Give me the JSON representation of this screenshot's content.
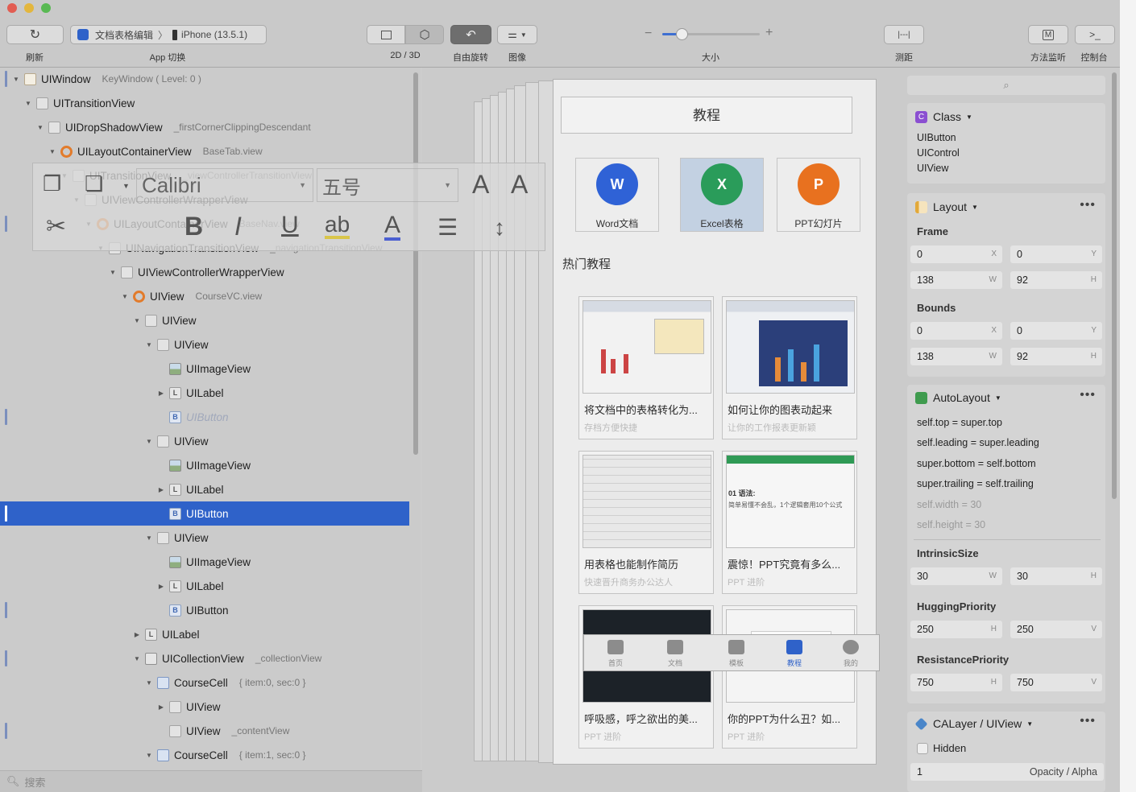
{
  "window_controls": {
    "colors": [
      "#e25d52",
      "#e3b63d",
      "#59b953"
    ]
  },
  "toolbar": {
    "refresh_label": "刷新",
    "app_switch_label": "App 切换",
    "app_name": "文档表格编辑",
    "device_name": "iPhone (13.5.1)",
    "view_mode_label": "2D / 3D",
    "free_rotate_label": "自由旋转",
    "image_label": "图像",
    "size_label": "大小",
    "measure_label": "测距",
    "measure_icon": "|---|",
    "method_monitor_label": "方法监听",
    "console_label": "控制台",
    "method_icon": "M",
    "console_icon": ">_",
    "zoom_level": 0.2
  },
  "hierarchy": [
    {
      "label": "UIWindow",
      "sub": "KeyWindow ( Level: 0 )",
      "icon": "window-icon"
    },
    {
      "label": "UITransitionView",
      "sub": "",
      "icon": "view-icon"
    },
    {
      "label": "UIDropShadowView",
      "sub": "_firstCornerClippingDescendant",
      "icon": "view-icon"
    },
    {
      "label": "UILayoutContainerView",
      "sub": "BaseTab.view",
      "icon": "controller-icon"
    },
    {
      "label": "UITransitionView",
      "sub": "_viewControllerTransitionView",
      "icon": "view-icon"
    },
    {
      "label": "UIViewControllerWrapperView",
      "sub": "",
      "icon": "view-icon"
    },
    {
      "label": "UILayoutContainerView",
      "sub": "BaseNav.view",
      "icon": "controller-icon"
    },
    {
      "label": "UINavigationTransitionView",
      "sub": "_navigationTransitionView",
      "icon": "view-icon"
    },
    {
      "label": "UIViewControllerWrapperView",
      "sub": "",
      "icon": "view-icon"
    },
    {
      "label": "UIView",
      "sub": "CourseVC.view",
      "icon": "controller-icon"
    },
    {
      "label": "UIView",
      "sub": "",
      "icon": "view-icon"
    },
    {
      "label": "UIView",
      "sub": "",
      "icon": "view-icon"
    },
    {
      "label": "UIImageView",
      "sub": "",
      "icon": "image-icon"
    },
    {
      "label": "UILabel",
      "sub": "",
      "icon": "label-icon"
    },
    {
      "label": "UIButton",
      "sub": "",
      "icon": "button-icon"
    },
    {
      "label": "UIView",
      "sub": "",
      "icon": "view-icon"
    },
    {
      "label": "UIImageView",
      "sub": "",
      "icon": "image-icon"
    },
    {
      "label": "UILabel",
      "sub": "",
      "icon": "label-icon"
    },
    {
      "label": "UIButton",
      "sub": "",
      "icon": "button-icon"
    },
    {
      "label": "UIView",
      "sub": "",
      "icon": "view-icon"
    },
    {
      "label": "UIImageView",
      "sub": "",
      "icon": "image-icon"
    },
    {
      "label": "UILabel",
      "sub": "",
      "icon": "label-icon"
    },
    {
      "label": "UIButton",
      "sub": "",
      "icon": "button-icon"
    },
    {
      "label": "UILabel",
      "sub": "",
      "icon": "label-icon"
    },
    {
      "label": "UICollectionView",
      "sub": "_collectionView",
      "icon": "collection-icon"
    },
    {
      "label": "CourseCell",
      "sub": "{ item:0, sec:0 }",
      "icon": "cell-icon"
    },
    {
      "label": "UIView",
      "sub": "",
      "icon": "view-icon"
    },
    {
      "label": "UIView",
      "sub": "_contentView",
      "icon": "view-icon"
    },
    {
      "label": "CourseCell",
      "sub": "{ item:1, sec:0 }",
      "icon": "cell-icon"
    }
  ],
  "hierarchy_search_placeholder": "搜索",
  "format_bar": {
    "font_name": "Calibri",
    "font_size": "五号"
  },
  "phone": {
    "nav_title": "教程",
    "apps": [
      {
        "label": "Word文档",
        "glyph": "W",
        "color": "#2f62d6"
      },
      {
        "label": "Excel表格",
        "glyph": "X",
        "color": "#2a9c5a"
      },
      {
        "label": "PPT幻灯片",
        "glyph": "P",
        "color": "#e8711f"
      }
    ],
    "section_title": "热门教程",
    "courses": [
      {
        "title": "将文档中的表格转化为...",
        "subtitle": "存档方便快捷"
      },
      {
        "title": "如何让你的图表动起来",
        "subtitle": "让你的工作报表更新颖"
      },
      {
        "title": "用表格也能制作简历",
        "subtitle": "快速晋升商务办公达人"
      },
      {
        "title": "震惊！PPT究竟有多么...",
        "subtitle": "PPT 进阶"
      },
      {
        "title": "呼吸感，呼之欲出的美...",
        "subtitle": "PPT 进阶"
      },
      {
        "title": "你的PPT为什么丑？如...",
        "subtitle": "PPT 进阶"
      }
    ],
    "thumb_heading": "01 语法:",
    "thumb_text": "简单易懂不会乱，1个逻辑套用10个公式",
    "tabs": [
      "首页",
      "文档",
      "模板",
      "教程",
      "我的"
    ]
  },
  "inspector": {
    "class_section": {
      "title": "Class",
      "items": [
        "UIButton",
        "UIControl",
        "UIView"
      ]
    },
    "layout_section": {
      "title": "Layout",
      "frame_label": "Frame",
      "frame": {
        "x": "0",
        "y": "0",
        "w": "138",
        "h": "92"
      },
      "bounds_label": "Bounds",
      "bounds": {
        "x": "0",
        "y": "0",
        "w": "138",
        "h": "92"
      }
    },
    "autolayout_section": {
      "title": "AutoLayout",
      "constraints": [
        "self.top = super.top",
        "self.leading = super.leading",
        "super.bottom = self.bottom",
        "super.trailing = self.trailing"
      ],
      "inactive_constraints": [
        "self.width = 30",
        "self.height = 30"
      ],
      "intrinsic_label": "IntrinsicSize",
      "intrinsic": {
        "w": "30",
        "h": "30"
      },
      "hugging_label": "HuggingPriority",
      "hugging": {
        "h": "250",
        "v": "250"
      },
      "resistance_label": "ResistancePriority",
      "resistance": {
        "h": "750",
        "v": "750"
      }
    },
    "layer_section": {
      "title": "CALayer / UIView",
      "hidden_label": "Hidden",
      "opacity_value": "1",
      "opacity_label": "Opacity / Alpha"
    },
    "axis": {
      "x": "X",
      "y": "Y",
      "w": "W",
      "h": "H",
      "v": "V"
    }
  }
}
